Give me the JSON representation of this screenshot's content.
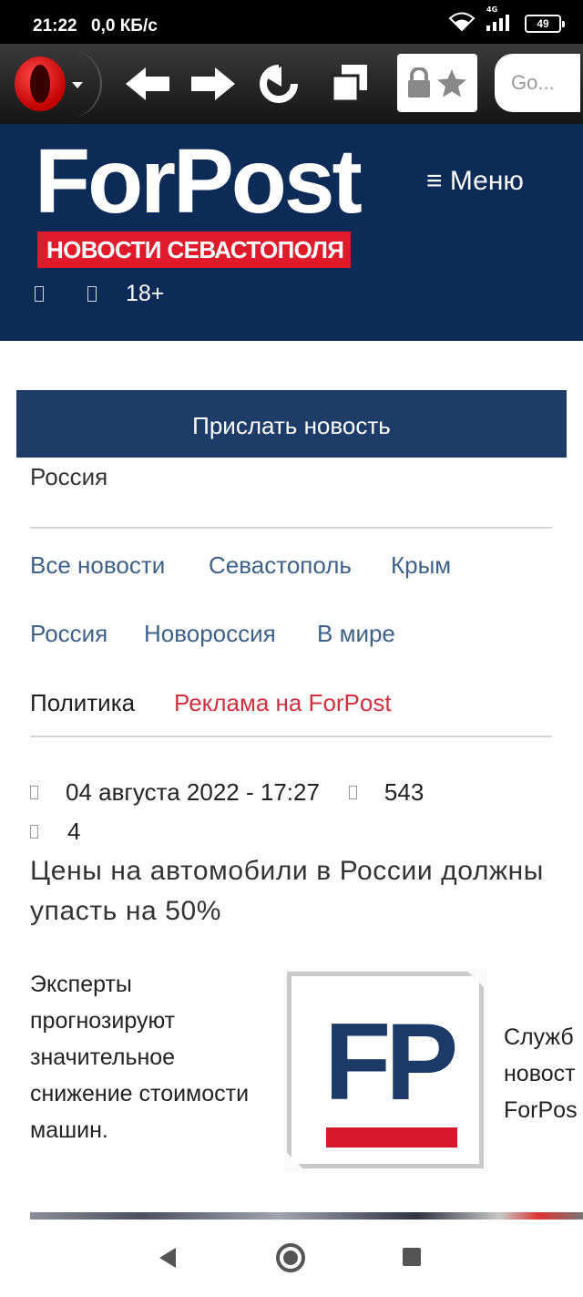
{
  "status_bar": {
    "time": "21:22",
    "speed": "0,0 КБ/с",
    "network_label": "4G",
    "battery": "49"
  },
  "browser": {
    "search_placeholder": "Go...",
    "icons": [
      "opera-logo-icon",
      "back-arrow-icon",
      "forward-arrow-icon",
      "reload-icon",
      "tabs-icon",
      "lock-icon",
      "star-icon"
    ]
  },
  "site": {
    "logo": "ForPost",
    "tagline": "НОВОСТИ СЕВАСТОПОЛЯ",
    "menu": "≡ Меню",
    "age_rating": "18+",
    "brand_colors": {
      "header_bg": "#0d2b57",
      "accent_red": "#e01a2b",
      "button_bg": "#1d3c67",
      "link": "#3d6188"
    }
  },
  "content": {
    "send_news_button": "Прислать новость",
    "section": "Россия",
    "nav": {
      "all_news": "Все новости",
      "sevastopol": "Севастополь",
      "crimea": "Крым",
      "russia": "Россия",
      "novorossiya": "Новороссия",
      "world": "В мире",
      "politics": "Политика",
      "ads": "Реклама на ForPost"
    },
    "article": {
      "date": "04 августа 2022 - 17:27",
      "views": "543",
      "comments": "4",
      "title": "Цены на автомобили в России должны упасть на 50%",
      "lead": "Эксперты прогнозируют значительное снижение стоимости машин.",
      "image_caption_lines": [
        "Служб",
        "новост",
        "ForPos"
      ],
      "image_letters": "FP"
    }
  }
}
